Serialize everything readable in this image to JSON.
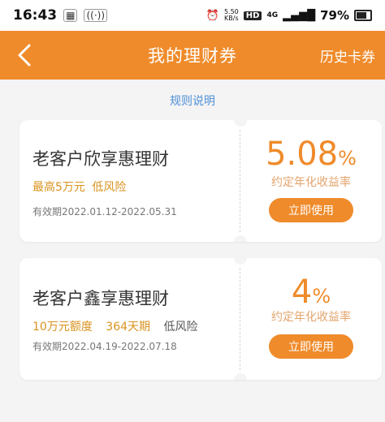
{
  "status_bar": {
    "time": "16:43",
    "net_speed_value": "5.50",
    "net_speed_unit": "KB/s",
    "hd_badge": "HD",
    "network": "4G",
    "battery": "79%"
  },
  "header": {
    "title": "我的理财券",
    "history_label": "历史卡券",
    "bg_color": "#ef8b2b"
  },
  "rules_link": "规则说明",
  "coupons": [
    {
      "name": "老客户欣享惠理财",
      "limit": "最高5万元",
      "risk": "低风险",
      "validity": "有效期2022.01.12-2022.05.31",
      "rate_value": "5.08",
      "rate_unit": "%",
      "rate_label": "约定年化收益率",
      "button": "立即使用"
    },
    {
      "name": "老客户鑫享惠理财",
      "limit": "10万元额度",
      "term": "364天期",
      "risk": "低风险",
      "validity": "有效期2022.04.19-2022.07.18",
      "rate_value": "4",
      "rate_unit": "%",
      "rate_label": "约定年化收益率",
      "button": "立即使用"
    }
  ]
}
